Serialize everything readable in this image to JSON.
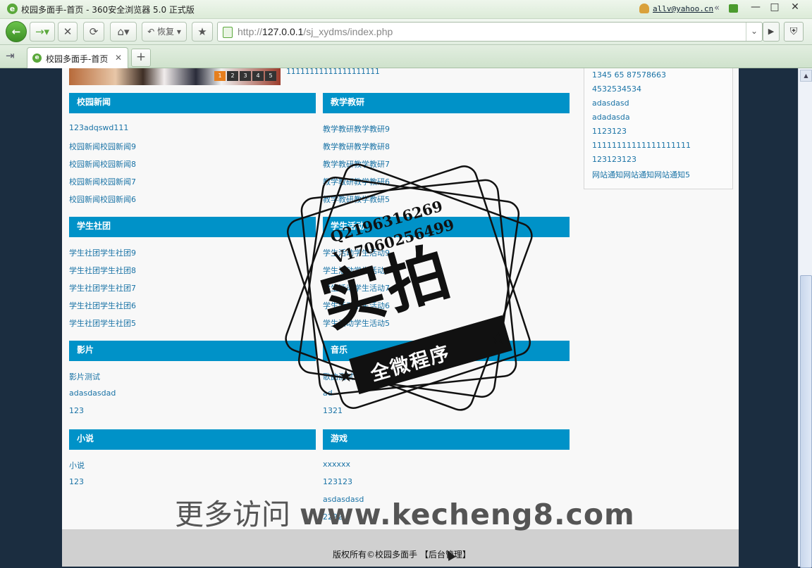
{
  "window": {
    "title": "校园多面手-首页 - 360安全浏览器 5.0 正式版",
    "user": "allv@yahoo.cn",
    "controls": [
      "«",
      "—",
      "□",
      "✕"
    ]
  },
  "toolbar": {
    "back_icon": "arrow-left-icon",
    "forward_icon": "arrow-right-icon",
    "stop_label": "✕",
    "refresh_label": "⟳",
    "home_label": "⌂",
    "restore_label": "恢复",
    "favorite_label": "★",
    "url_prefix": "http://",
    "url_host": "127.0.0.1",
    "url_path": "/sj_xydms/index.php"
  },
  "tabs": [
    {
      "label": "校园多面手-首页",
      "active": true
    }
  ],
  "page": {
    "banner_pages": [
      "1",
      "2",
      "3",
      "4",
      "5"
    ],
    "top_line": "11111111111111111111",
    "sections": [
      {
        "title": "校园新闻",
        "items": [
          "123adqswd111",
          "校园新闻校园新闻9",
          "校园新闻校园新闻8",
          "校园新闻校园新闻7",
          "校园新闻校园新闻6"
        ]
      },
      {
        "title": "教学教研",
        "items": [
          "教学教研教学教研9",
          "教学教研教学教研8",
          "教学教研教学教研7",
          "教学教研教学教研6",
          "教学教研教学教研5"
        ]
      },
      {
        "title": "学生社团",
        "items": [
          "学生社团学生社团9",
          "学生社团学生社团8",
          "学生社团学生社团7",
          "学生社团学生社团6",
          "学生社团学生社团5"
        ]
      },
      {
        "title": "学生活动",
        "items": [
          "学生活动学生活动9",
          "学生活动学生活动8",
          "学生活动学生活动7",
          "学生活动学生活动6",
          "学生活动学生活动5"
        ]
      },
      {
        "title": "影片",
        "items": [
          "影片测试",
          "adasdasdad",
          "123"
        ]
      },
      {
        "title": "音乐",
        "items": [
          "歌曲测试",
          "ad",
          "1321"
        ]
      },
      {
        "title": "小说",
        "items": [
          "小说",
          "123"
        ]
      },
      {
        "title": "游戏",
        "items": [
          "xxxxxx",
          "123123",
          "asdasdasd",
          "2222"
        ]
      }
    ],
    "notice_items": [
      "1345 65 87578663",
      "4532534534",
      "adasdasd",
      "adadasda",
      "1123123",
      "11111111111111111111",
      "123123123",
      "网站通知网站通知网站通知5"
    ],
    "footer_text": "版权所有©校园多面手 【后台管理】"
  },
  "overlay": {
    "qq": "Q2196316269",
    "vx": "V17060256499",
    "stamp_big": "实拍",
    "stamp_ribbon": "全微程序",
    "watermark_prefix": "更多访问 ",
    "watermark_domain": "www.kecheng8.com"
  }
}
